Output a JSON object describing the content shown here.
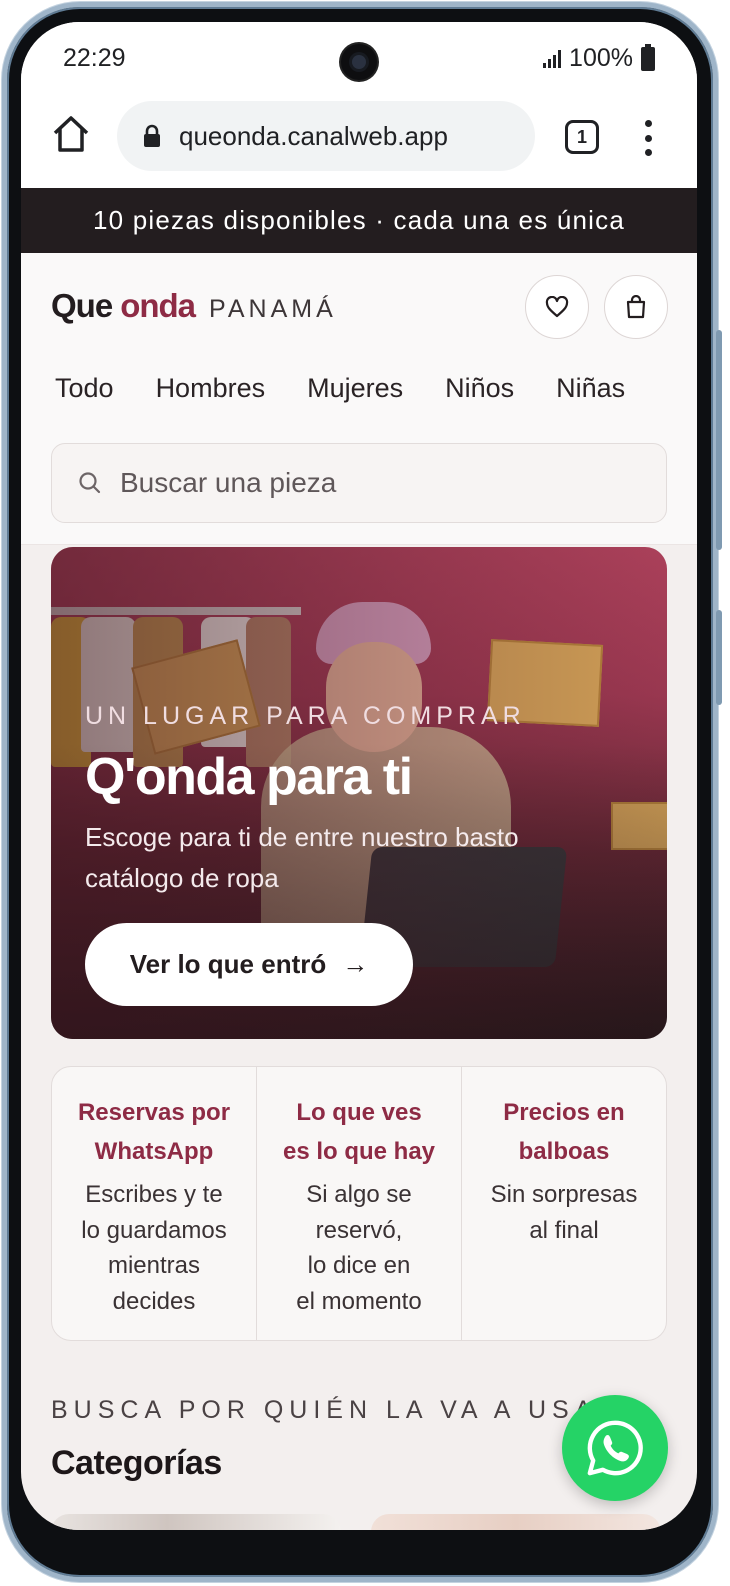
{
  "status_bar": {
    "time": "22:29",
    "battery": "100%"
  },
  "browser": {
    "url": "queonda.canalweb.app",
    "tab_count": "1"
  },
  "announcement": "10 piezas disponibles · cada una es única",
  "header": {
    "logo_que": "Que",
    "logo_onda": "onda",
    "logo_region": "PANAMÁ",
    "nav": [
      "Todo",
      "Hombres",
      "Mujeres",
      "Niños",
      "Niñas"
    ],
    "search_placeholder": "Buscar una pieza"
  },
  "hero": {
    "eyebrow": "UN LUGAR PARA COMPRAR",
    "title": "Q'onda para ti",
    "description": "Escoge para ti de entre nuestro basto catálogo de ropa",
    "cta": "Ver lo que entró",
    "cta_arrow": "→"
  },
  "features": [
    {
      "title": "Reservas por\nWhatsApp",
      "text": "Escribes y te\nlo guardamos\nmientras\ndecides"
    },
    {
      "title": "Lo que ves\nes lo que hay",
      "text": "Si algo se\nreservó,\nlo dice en\nel momento"
    },
    {
      "title": "Precios en\nbalboas",
      "text": "Sin sorpresas\nal final"
    }
  ],
  "categories": {
    "eyebrow": "BUSCA POR QUIÉN LA VA A USAR",
    "title": "Categorías"
  },
  "icons": {
    "home": "home-icon",
    "lock": "lock-icon",
    "menu": "more-vert-icon",
    "wishlist": "heart-icon",
    "bag": "shopping-bag-icon",
    "search": "search-icon",
    "whatsapp": "whatsapp-icon"
  },
  "colors": {
    "brand": "#8e2b45",
    "dark": "#231d1f",
    "whatsapp": "#25d366"
  }
}
